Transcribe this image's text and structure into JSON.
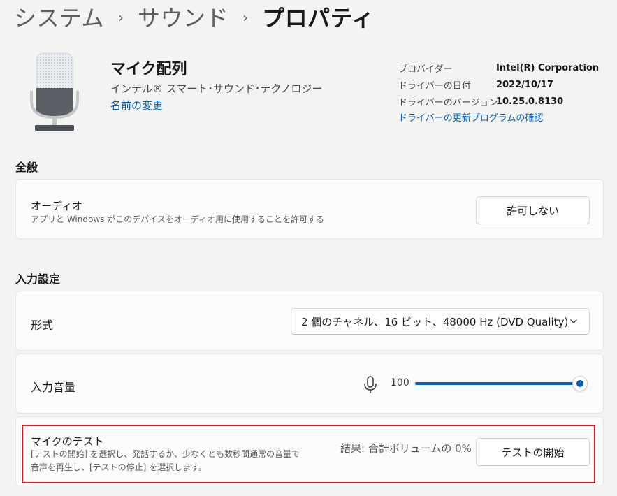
{
  "breadcrumb": {
    "items": [
      "システム",
      "サウンド",
      "プロパティ"
    ],
    "separator": "›"
  },
  "device": {
    "name": "マイク配列",
    "manufacturer": "インテル® スマート･サウンド･テクノロジー",
    "rename_link": "名前の変更",
    "icon": "microphone-icon"
  },
  "driver": {
    "rows": [
      {
        "label": "プロバイダー",
        "value": "Intel(R) Corporation"
      },
      {
        "label": "ドライバーの日付",
        "value": "2022/10/17"
      },
      {
        "label": "ドライバーのバージョン",
        "value": "10.25.0.8130"
      }
    ],
    "update_link": "ドライバーの更新プログラムの確認"
  },
  "general": {
    "title": "全般",
    "audio": {
      "title": "オーディオ",
      "description": "アプリと Windows がこのデバイスをオーディオ用に使用することを許可する",
      "button": "許可しない"
    }
  },
  "input": {
    "title": "入力設定",
    "format": {
      "label": "形式",
      "selected": "2 個のチャネル、16 ビット、48000 Hz (DVD Quality)"
    },
    "volume": {
      "label": "入力音量",
      "value": "100",
      "level": 100
    },
    "mic_test": {
      "title": "マイクのテスト",
      "description_line1": "[テストの開始] を選択し、発話するか、少なくとも数秒間通常の音量で",
      "description_line2": "音声を再生し、[テストの停止] を選択します。",
      "result": "結果: 合計ボリュームの 0%",
      "button": "テストの開始"
    }
  },
  "colors": {
    "accent": "#005fb8",
    "highlight": "#e0141e",
    "background": "#f3f3f3",
    "card": "#fbfbfb"
  }
}
